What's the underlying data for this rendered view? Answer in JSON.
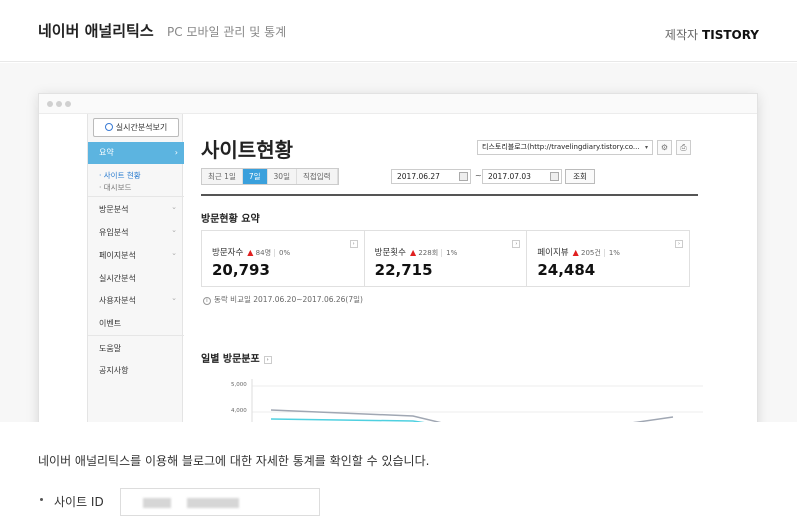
{
  "header": {
    "title": "네이버 애널리틱스",
    "subtitle": "PC 모바일 관리 및 통계",
    "maker_label": "제작자",
    "maker_name": "TISTORY"
  },
  "preview": {
    "sidebar": {
      "realtime_button": "실시간분석보기",
      "summary_label": "요약",
      "sub_items": [
        "· 사이트 현황",
        "· 대시보드"
      ],
      "items": [
        {
          "label": "방문분석",
          "expand": true
        },
        {
          "label": "유입분석",
          "expand": true
        },
        {
          "label": "페이지분석",
          "expand": true
        },
        {
          "label": "실시간분석",
          "expand": false
        },
        {
          "label": "사용자분석",
          "expand": true
        },
        {
          "label": "이벤트",
          "expand": false
        }
      ],
      "footer_items": [
        "도움말",
        "공지사항"
      ]
    },
    "main": {
      "title": "사이트현황",
      "site_select": "티스토리블로그(http://travelingdiary.tistory.co...",
      "period_tabs": [
        {
          "label": "최근 1일",
          "active": false
        },
        {
          "label": "7일",
          "active": true
        },
        {
          "label": "30일",
          "active": false
        },
        {
          "label": "직접입력",
          "active": false
        }
      ],
      "date_from": "2017.06.27",
      "date_to": "2017.07.03",
      "range_separator": "~",
      "query_button": "조회",
      "summary_title": "방문현황 요약",
      "stats": [
        {
          "label": "방문자수",
          "delta": "84명",
          "pct": "0%",
          "value": "20,793"
        },
        {
          "label": "방문횟수",
          "delta": "228회",
          "pct": "1%",
          "value": "22,715"
        },
        {
          "label": "페이지뷰",
          "delta": "205건",
          "pct": "1%",
          "value": "24,484"
        }
      ],
      "compare_text": "동락 비교일  2017.06.20~2017.06.26(7일)",
      "daily_title": "일별 방문분포",
      "y_ticks": [
        "5,000",
        "4,000"
      ],
      "line_colors": [
        "#a0a7b3",
        "#4fd0e0",
        "#58c46a",
        "#7a4fc0"
      ]
    }
  },
  "description": "네이버 애널리틱스를 이용해 블로그에 대한 자세한 통계를 확인할 수 있습니다.",
  "site_id": {
    "label": "사이트 ID"
  }
}
